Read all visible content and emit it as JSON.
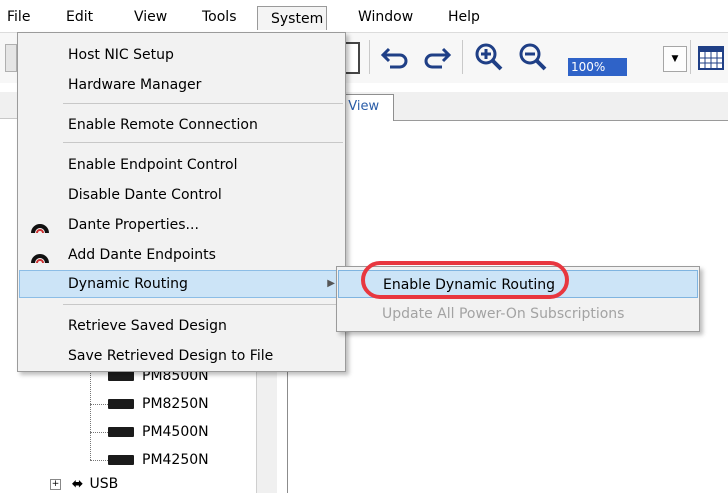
{
  "menubar": {
    "items": [
      {
        "label": "File"
      },
      {
        "label": "Edit"
      },
      {
        "label": "View"
      },
      {
        "label": "Tools"
      },
      {
        "label": "System"
      },
      {
        "label": "Window"
      },
      {
        "label": "Help"
      }
    ]
  },
  "toolbar": {
    "zoom_value": "100%",
    "icons": [
      "undo-icon",
      "redo-icon",
      "zoom-in-icon",
      "zoom-out-icon",
      "dropdown-arrow-icon",
      "grid-icon"
    ]
  },
  "tab": {
    "label": "t View"
  },
  "system_menu": {
    "items": [
      {
        "label": "Host NIC Setup"
      },
      {
        "label": "Hardware Manager"
      },
      {
        "label": "Enable Remote Connection"
      },
      {
        "label": "Enable Endpoint Control"
      },
      {
        "label": "Disable Dante Control"
      },
      {
        "label": "Dante Properties..."
      },
      {
        "label": "Add Dante Endpoints"
      },
      {
        "label": "Dynamic Routing"
      },
      {
        "label": "Retrieve Saved Design"
      },
      {
        "label": "Save Retrieved Design to File"
      }
    ]
  },
  "dynamic_routing_submenu": {
    "items": [
      {
        "label": "Enable Dynamic Routing",
        "highlighted": true
      },
      {
        "label": "Update All Power-On Subscriptions",
        "disabled": true
      }
    ]
  },
  "tree": {
    "items": [
      {
        "label": "PM8500N"
      },
      {
        "label": "PM8250N"
      },
      {
        "label": "PM4500N"
      },
      {
        "label": "PM4250N"
      },
      {
        "label": "USB"
      }
    ]
  },
  "colors": {
    "highlight": "#cce4f7",
    "highlight_border": "#8cbde6",
    "annotation_oval": "#e8373f",
    "zoom_box": "#2f63c8",
    "tab_text": "#2a5da8"
  }
}
